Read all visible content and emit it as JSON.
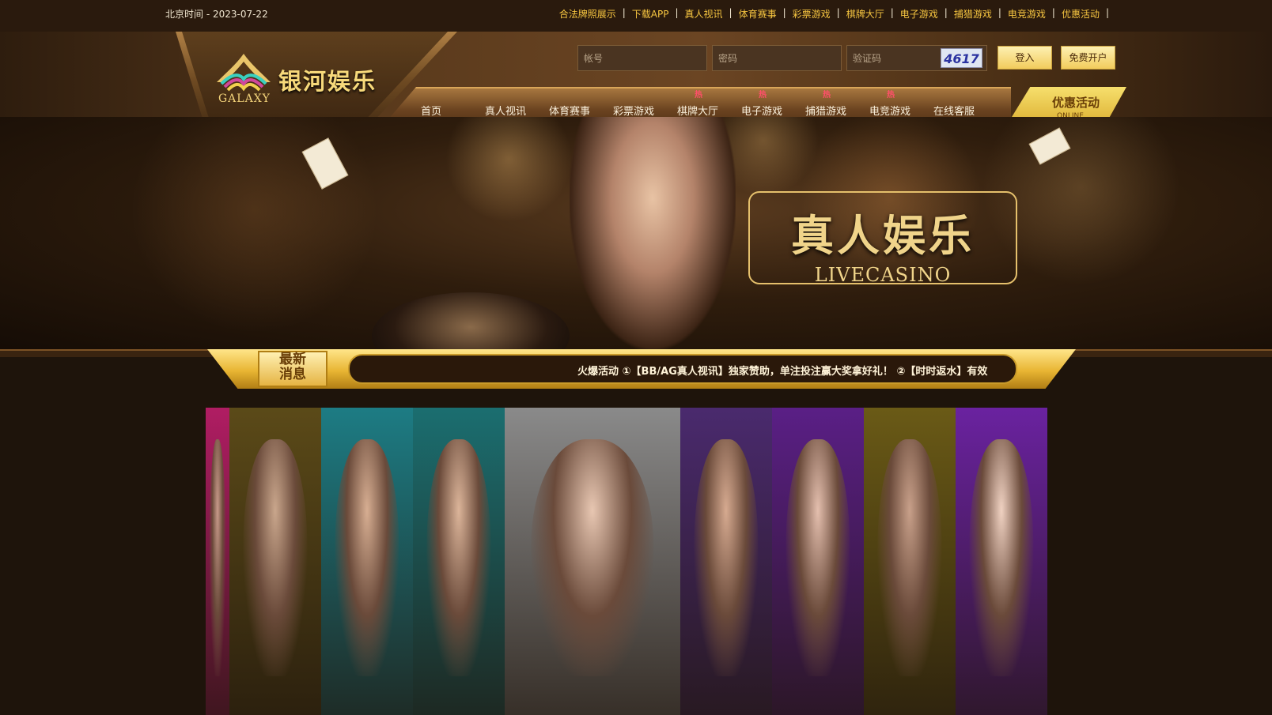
{
  "topbar": {
    "date": "北京时间 - 2023-07-22",
    "links": [
      "合法牌照展示",
      "下载APP",
      "真人视讯",
      "体育赛事",
      "彩票游戏",
      "棋牌大厅",
      "电子游戏",
      "捕猎游戏",
      "电竞游戏",
      "优惠活动"
    ]
  },
  "logo": {
    "name": "银河娱乐",
    "sub": "GALAXY"
  },
  "login": {
    "username_placeholder": "帐号",
    "password_placeholder": "密码",
    "captcha_placeholder": "验证码",
    "captcha_code": "4617",
    "login_label": "登入",
    "register_label": "免费开户"
  },
  "nav": {
    "items": [
      {
        "label": "首页",
        "hot": ""
      },
      {
        "label": "真人视讯",
        "hot": ""
      },
      {
        "label": "体育赛事",
        "hot": ""
      },
      {
        "label": "彩票游戏",
        "hot": ""
      },
      {
        "label": "棋牌大厅",
        "hot": "热"
      },
      {
        "label": "电子游戏",
        "hot": "热"
      },
      {
        "label": "捕猎游戏",
        "hot": "热"
      },
      {
        "label": "电竞游戏",
        "hot": "热"
      },
      {
        "label": "在线客服",
        "hot": ""
      }
    ],
    "promo_title": "优惠活动",
    "promo_sub": "ONLINE"
  },
  "banner": {
    "title": "真人娱乐",
    "subtitle": "LIVECASINO"
  },
  "news": {
    "badge": "最新消息",
    "text": "火爆活动 ①【BB/AG真人视讯】独家赞助，单注投注赢大奖拿好礼！ ②【时时返水】有效"
  },
  "gallery": {
    "panels": [
      {
        "bg": "#b01d63",
        "tone": "#c89a8a"
      },
      {
        "bg": "#5b4a18",
        "tone": "#c9a68c"
      },
      {
        "bg": "#1d7c84",
        "tone": "#d7ae92"
      },
      {
        "bg": "#1b6e70",
        "tone": "#dcb59a"
      },
      {
        "bg": "#8a8a8a",
        "tone": "#e8c7b2"
      },
      {
        "bg": "#4a2a6e",
        "tone": "#d6aa90"
      },
      {
        "bg": "#5a1f86",
        "tone": "#e4bfae"
      },
      {
        "bg": "#6a5a16",
        "tone": "#c8a08a"
      },
      {
        "bg": "#6a22a0",
        "tone": "#f0d2c2"
      }
    ]
  },
  "colors": {
    "accent": "#f7c641",
    "background": "#1e140b",
    "hot": "#ff4f6a"
  }
}
